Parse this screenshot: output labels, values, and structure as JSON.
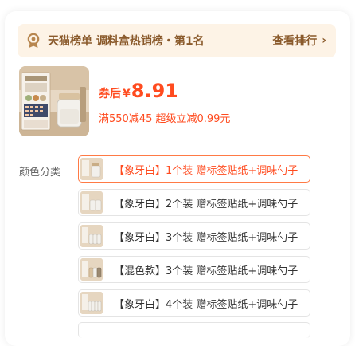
{
  "rank_banner": {
    "title": "天猫榜单 调料盒热销榜・第1名",
    "link_label": "查看排行",
    "icon": "ranking-badge-icon"
  },
  "product": {
    "image": "seasoning-jar-product-image",
    "price_prefix": "券后",
    "currency": "¥",
    "price": "8.91",
    "promo": "满550减45 超级立减0.99元"
  },
  "colors": {
    "accent": "#ff4b1f",
    "selected_border": "#ff7a45",
    "banner_bg": "#fdf3e6",
    "banner_text": "#8a5a2b"
  },
  "variant_section": {
    "label": "颜色分类",
    "selected_index": 0,
    "options": [
      {
        "label": "【象牙白】1个装 赠标签贴纸+调味勺子"
      },
      {
        "label": "【象牙白】2个装 赠标签贴纸+调味勺子"
      },
      {
        "label": "【象牙白】3个装 赠标签贴纸+调味勺子"
      },
      {
        "label": "【混色款】3个装 赠标签贴纸+调味勺子"
      },
      {
        "label": "【象牙白】4个装 赠标签贴纸+调味勺子"
      }
    ]
  }
}
